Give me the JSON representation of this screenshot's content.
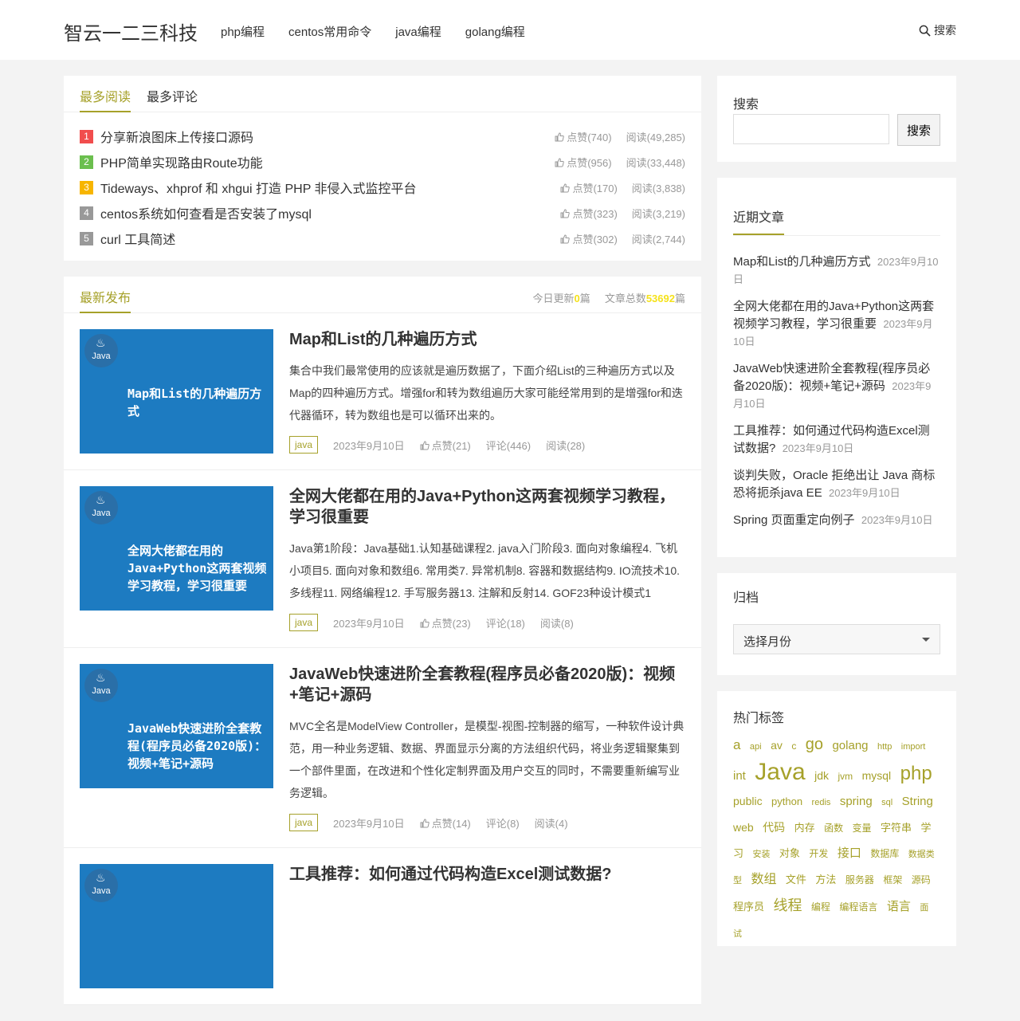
{
  "header": {
    "logo": "智云一二三科技",
    "nav": [
      "php编程",
      "centos常用命令",
      "java编程",
      "golang编程"
    ],
    "search": "搜索"
  },
  "hot": {
    "tabs": [
      "最多阅读",
      "最多评论"
    ],
    "items": [
      {
        "rank": "1",
        "color": "#f14d4d",
        "title": "分享新浪图床上传接口源码",
        "likes": "点赞(740)",
        "reads": "阅读(49,285)"
      },
      {
        "rank": "2",
        "color": "#6bbf4e",
        "title": "PHP简单实现路由Route功能",
        "likes": "点赞(956)",
        "reads": "阅读(33,448)"
      },
      {
        "rank": "3",
        "color": "#f7b500",
        "title": "Tideways、xhprof 和 xhgui 打造 PHP 非侵入式监控平台",
        "likes": "点赞(170)",
        "reads": "阅读(3,838)"
      },
      {
        "rank": "4",
        "color": "#999999",
        "title": "centos系统如何查看是否安装了mysql",
        "likes": "点赞(323)",
        "reads": "阅读(3,219)"
      },
      {
        "rank": "5",
        "color": "#999999",
        "title": "curl 工具简述",
        "likes": "点赞(302)",
        "reads": "阅读(2,744)"
      }
    ]
  },
  "latest": {
    "title": "最新发布",
    "today_label": "今日更新",
    "today": "0",
    "unit": "篇",
    "total_label": "文章总数",
    "total": "53692",
    "posts": [
      {
        "thumb": "Map和List的几种遍历方式",
        "title": "Map和List的几种遍历方式",
        "excerpt": "集合中我们最常使用的应该就是遍历数据了，下面介绍List的三种遍历方式以及Map的四种遍历方式。增强for和转为数组遍历大家可能经常用到的是增强for和迭代器循环，转为数组也是可以循环出来的。",
        "tag": "java",
        "date": "2023年9月10日",
        "likes": "点赞(21)",
        "comments": "评论(446)",
        "reads": "阅读(28)"
      },
      {
        "thumb": "全网大佬都在用的Java+Python这两套视频学习教程，学习很重要",
        "title": "全网大佬都在用的Java+Python这两套视频学习教程，学习很重要",
        "excerpt": "Java第1阶段：Java基础1.认知基础课程2. java入门阶段3. 面向对象编程4. 飞机小项目5. 面向对象和数组6. 常用类7. 异常机制8. 容器和数据结构9. IO流技术10. 多线程11. 网络编程12. 手写服务器13. 注解和反射14. GOF23种设计模式1",
        "tag": "java",
        "date": "2023年9月10日",
        "likes": "点赞(23)",
        "comments": "评论(18)",
        "reads": "阅读(8)"
      },
      {
        "thumb": "JavaWeb快速进阶全套教程(程序员必备2020版)：视频+笔记+源码",
        "title": "JavaWeb快速进阶全套教程(程序员必备2020版)：视频+笔记+源码",
        "excerpt": "MVC全名是ModelView Controller，是模型-视图-控制器的缩写，一种软件设计典范，用一种业务逻辑、数据、界面显示分离的方法组织代码，将业务逻辑聚集到一个部件里面，在改进和个性化定制界面及用户交互的同时，不需要重新编写业务逻辑。",
        "tag": "java",
        "date": "2023年9月10日",
        "likes": "点赞(14)",
        "comments": "评论(8)",
        "reads": "阅读(4)"
      },
      {
        "thumb": "",
        "title": "工具推荐：如何通过代码构造Excel测试数据?",
        "excerpt": "",
        "tag": "",
        "date": "",
        "likes": "",
        "comments": "",
        "reads": ""
      }
    ]
  },
  "sidebar": {
    "search_title": "搜索",
    "search_button": "搜索",
    "search_value": "",
    "recent_title": "近期文章",
    "recent": [
      {
        "title": "Map和List的几种遍历方式",
        "date": "2023年9月10日"
      },
      {
        "title": "全网大佬都在用的Java+Python这两套视频学习教程，学习很重要",
        "date": "2023年9月10日"
      },
      {
        "title": "JavaWeb快速进阶全套教程(程序员必备2020版)：视频+笔记+源码",
        "date": "2023年9月10日"
      },
      {
        "title": "工具推荐：如何通过代码构造Excel测试数据?",
        "date": "2023年9月10日"
      },
      {
        "title": "谈判失败，Oracle 拒绝出让 Java 商标恐将扼杀java EE",
        "date": "2023年9月10日"
      },
      {
        "title": "Spring 页面重定向例子",
        "date": "2023年9月10日"
      }
    ],
    "archive_title": "归档",
    "archive_select": "选择月份",
    "tags_title": "热门标签",
    "tags": [
      {
        "t": "a",
        "s": 17
      },
      {
        "t": "api",
        "s": 11
      },
      {
        "t": "av",
        "s": 14
      },
      {
        "t": "c",
        "s": 12
      },
      {
        "t": "go",
        "s": 20
      },
      {
        "t": "golang",
        "s": 15
      },
      {
        "t": "http",
        "s": 11
      },
      {
        "t": "import",
        "s": 11
      },
      {
        "t": "int",
        "s": 15
      },
      {
        "t": "Java",
        "s": 30
      },
      {
        "t": "jdk",
        "s": 14
      },
      {
        "t": "jvm",
        "s": 12
      },
      {
        "t": "mysql",
        "s": 14
      },
      {
        "t": "php",
        "s": 24
      },
      {
        "t": "public",
        "s": 14
      },
      {
        "t": "python",
        "s": 13
      },
      {
        "t": "redis",
        "s": 11
      },
      {
        "t": "spring",
        "s": 15
      },
      {
        "t": "sql",
        "s": 11
      },
      {
        "t": "String",
        "s": 15
      },
      {
        "t": "web",
        "s": 14
      },
      {
        "t": "代码",
        "s": 14
      },
      {
        "t": "内存",
        "s": 13
      },
      {
        "t": "函数",
        "s": 12
      },
      {
        "t": "变量",
        "s": 12
      },
      {
        "t": "字符串",
        "s": 13
      },
      {
        "t": "学习",
        "s": 13
      },
      {
        "t": "安装",
        "s": 11
      },
      {
        "t": "对象",
        "s": 13
      },
      {
        "t": "开发",
        "s": 12
      },
      {
        "t": "接口",
        "s": 15
      },
      {
        "t": "数据库",
        "s": 12
      },
      {
        "t": "数据类型",
        "s": 11
      },
      {
        "t": "数组",
        "s": 16
      },
      {
        "t": "文件",
        "s": 13
      },
      {
        "t": "方法",
        "s": 13
      },
      {
        "t": "服务器",
        "s": 12
      },
      {
        "t": "框架",
        "s": 12
      },
      {
        "t": "源码",
        "s": 12
      },
      {
        "t": "程序员",
        "s": 13
      },
      {
        "t": "线程",
        "s": 18
      },
      {
        "t": "编程",
        "s": 12
      },
      {
        "t": "编程语言",
        "s": 12
      },
      {
        "t": "语言",
        "s": 15
      },
      {
        "t": "面试",
        "s": 11
      }
    ]
  }
}
